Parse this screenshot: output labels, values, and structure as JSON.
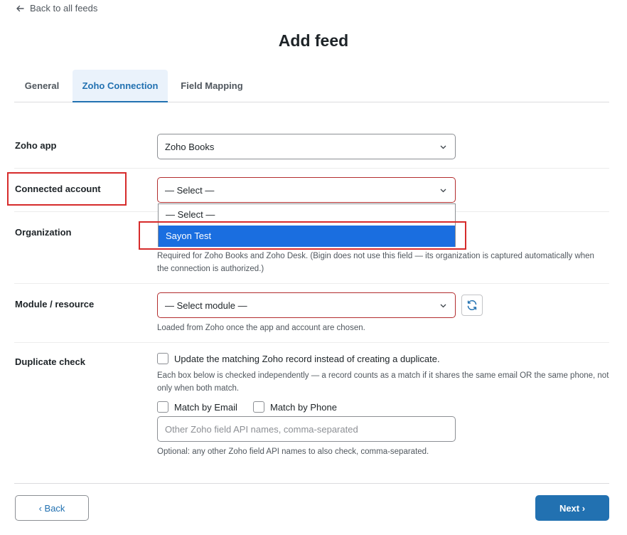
{
  "nav": {
    "back_to_feeds": "Back to all feeds"
  },
  "page": {
    "title": "Add feed"
  },
  "tabs": [
    {
      "label": "General"
    },
    {
      "label": "Zoho Connection",
      "active": true
    },
    {
      "label": "Field Mapping"
    }
  ],
  "form": {
    "zoho_app": {
      "label": "Zoho app",
      "value": "Zoho Books"
    },
    "connected_account": {
      "label": "Connected account",
      "value": "— Select —",
      "options": [
        "— Select —",
        "Sayon Test"
      ],
      "highlighted_option": "Sayon Test"
    },
    "organization": {
      "label": "Organization",
      "help": "Required for Zoho Books and Zoho Desk. (Bigin does not use this field — its organization is captured automatically when the connection is authorized.)"
    },
    "module": {
      "label": "Module / resource",
      "value": "— Select module —",
      "help": "Loaded from Zoho once the app and account are chosen."
    },
    "duplicate_check": {
      "label": "Duplicate check",
      "update_label": "Update the matching Zoho record instead of creating a duplicate.",
      "help": "Each box below is checked independently — a record counts as a match if it shares the same email OR the same phone, not only when both match.",
      "match_email_label": "Match by Email",
      "match_phone_label": "Match by Phone",
      "other_fields_placeholder": "Other Zoho field API names, comma-separated",
      "other_fields_help": "Optional: any other Zoho field API names to also check, comma-separated."
    }
  },
  "footer": {
    "back_label": "‹ Back",
    "next_label": "Next ›"
  },
  "colors": {
    "accent": "#2271b1",
    "error_border": "#b32d2e",
    "highlight_box": "#d62b2b",
    "option_selected": "#1a6ee0"
  }
}
